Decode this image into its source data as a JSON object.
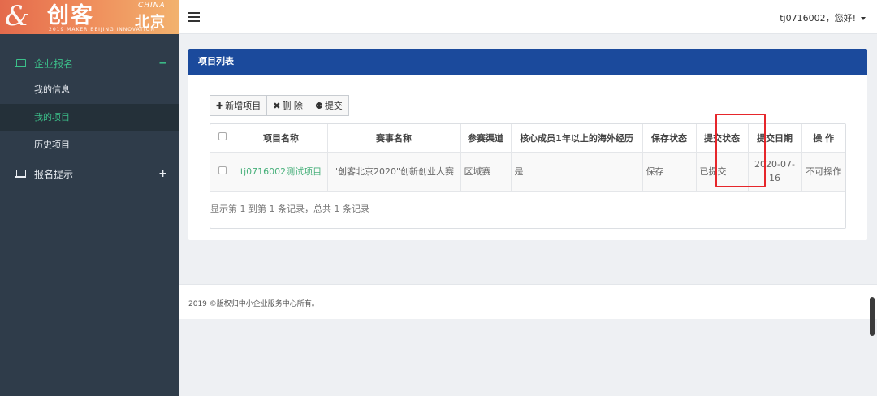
{
  "brand": {
    "logo_glyph": "&",
    "logo_text": "创客",
    "logo_china": "CHINA",
    "logo_beijing": "北京",
    "logo_sub": "2019 MAKER BEIJING INNOVATION"
  },
  "sidebar": {
    "groups": [
      {
        "label": "企业报名",
        "toggle": "−",
        "icon": "laptop-icon",
        "state": "expanded",
        "items": [
          {
            "label": "我的信息"
          },
          {
            "label": "我的项目",
            "selected": true
          },
          {
            "label": "历史项目"
          }
        ]
      },
      {
        "label": "报名提示",
        "toggle": "+",
        "icon": "laptop-icon",
        "state": "collapsed"
      }
    ]
  },
  "topbar": {
    "menu_icon": "hamburger-icon",
    "user_greeting": "tj0716002，您好!"
  },
  "panel": {
    "title": "项目列表",
    "toolbar": {
      "add": {
        "icon": "plus-icon",
        "glyph": "✚",
        "label": "新增项目"
      },
      "delete": {
        "icon": "close-icon",
        "glyph": "✖",
        "label": "删 除"
      },
      "submit": {
        "icon": "stamp-icon",
        "glyph": "⚉",
        "label": "提交"
      }
    },
    "table": {
      "headers": [
        "项目名称",
        "赛事名称",
        "参赛渠道",
        "核心成员1年以上的海外经历",
        "保存状态",
        "提交状态",
        "提交日期",
        "操 作"
      ],
      "rows": [
        {
          "project_name": "tj0716002测试项目",
          "event_name": "\"创客北京2020\"创新创业大赛",
          "channel": "区域赛",
          "overseas": "是",
          "save_status": "保存",
          "submit_status": "已提交",
          "submit_date": "2020-07-16",
          "action": "不可操作"
        }
      ],
      "summary": "显示第 1 到第 1 条记录，总共 1 条记录"
    }
  },
  "footer": {
    "copyright": "2019 ©版权归中小企业服务中心所有。"
  },
  "colors": {
    "sidebar_bg": "#2f3c4a",
    "accent_green": "#3cc08a",
    "panel_header": "#1b4a9c",
    "highlight_red": "#e6262b"
  }
}
